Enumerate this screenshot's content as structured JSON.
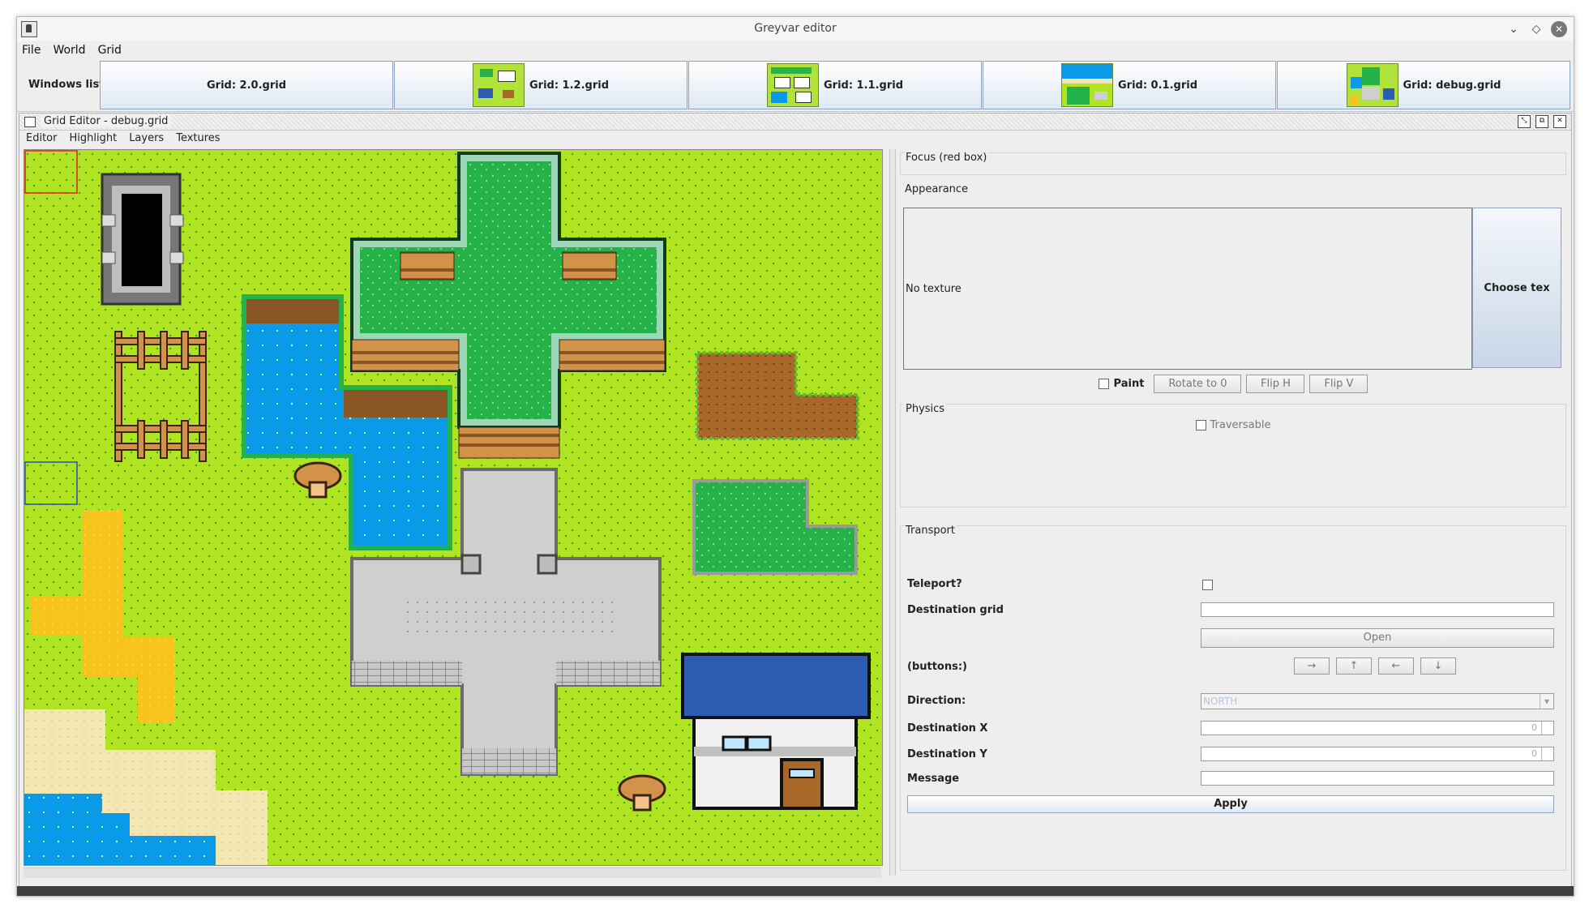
{
  "window": {
    "title": "Greyvar editor",
    "buttons": [
      "minimize",
      "maximize",
      "close"
    ]
  },
  "menubar": [
    "File",
    "World",
    "Grid"
  ],
  "windows_list": {
    "label": "Windows list",
    "items": [
      {
        "label": "Grid: 2.0.grid",
        "has_thumbnail": false
      },
      {
        "label": "Grid: 1.2.grid",
        "has_thumbnail": true
      },
      {
        "label": "Grid: 1.1.grid",
        "has_thumbnail": true
      },
      {
        "label": "Grid: 0.1.grid",
        "has_thumbnail": true
      },
      {
        "label": "Grid: debug.grid",
        "has_thumbnail": true
      }
    ]
  },
  "grid_editor": {
    "title": "Grid Editor - debug.grid",
    "menu": [
      "Editor",
      "Highlight",
      "Layers",
      "Textures"
    ]
  },
  "side": {
    "focus": {
      "title": "Focus (red box)"
    },
    "appearance": {
      "title": "Appearance",
      "no_texture": "No texture",
      "choose": "Choose tex",
      "paint_label": "Paint",
      "rotate": "Rotate to 0",
      "flip_h": "Flip H",
      "flip_v": "Flip V"
    },
    "physics": {
      "title": "Physics",
      "traversable": "Traversable"
    },
    "transport": {
      "title": "Transport",
      "teleport": "Teleport?",
      "dest_grid": "Destination grid",
      "open": "Open",
      "buttons_label": "(buttons:)",
      "arrows": [
        "→",
        "↑",
        "←",
        "↓"
      ],
      "direction_label": "Direction:",
      "direction_value": "NORTH",
      "dest_x": "Destination X",
      "dest_x_value": "0",
      "dest_y": "Destination Y",
      "dest_y_value": "0",
      "message": "Message",
      "apply": "Apply"
    }
  },
  "colors": {
    "grass": "#b0e320",
    "grass_dot": "#2f9b2a",
    "water": "#0a9be8",
    "sand": "#f2e6b3",
    "path_yellow": "#f6c21b",
    "stone": "#cfcfcf",
    "dirt": "#a8682a",
    "dark_green": "#26b24a",
    "roof": "#2c5db2",
    "focus_red": "#e02020",
    "focus_blue": "#2a4fb3"
  }
}
